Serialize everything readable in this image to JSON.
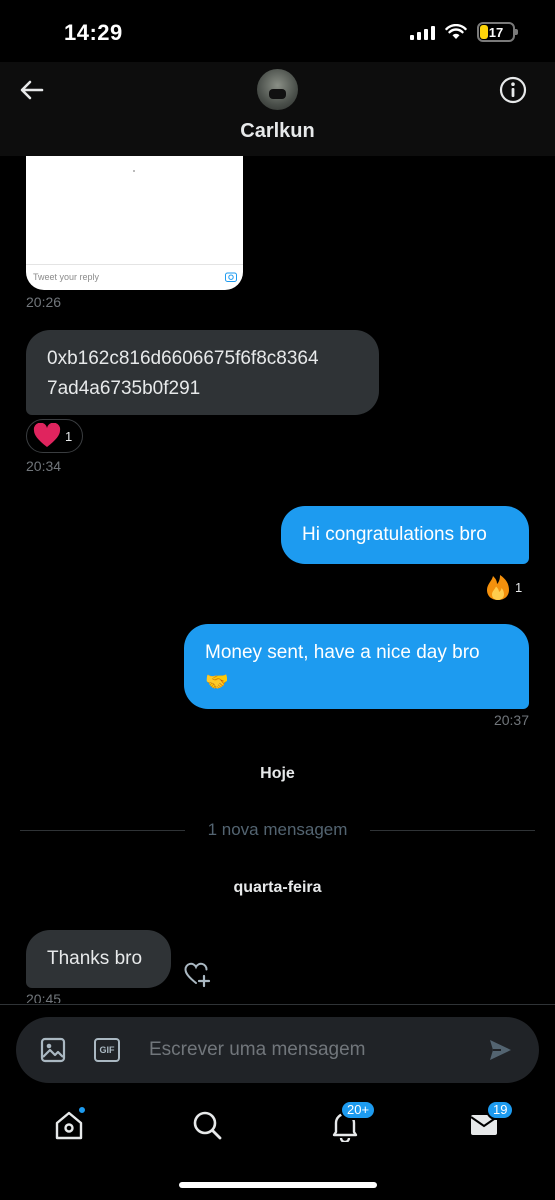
{
  "status_bar": {
    "time": "14:29",
    "battery": "17"
  },
  "header": {
    "name": "Carlkun"
  },
  "preview_card": {
    "reply_placeholder": "Tweet your reply"
  },
  "messages": [
    {
      "side": "in",
      "text": "",
      "time": "20:26"
    },
    {
      "side": "in",
      "text": "0xb162c816d6606675f6f8c8364\n7ad4a6735b0f291",
      "reaction": "heart",
      "reaction_count": "1",
      "time": "20:34"
    },
    {
      "side": "out",
      "text": "Hi congratulations bro",
      "reaction": "fire",
      "reaction_count": "1"
    },
    {
      "side": "out",
      "text": "Money sent, have a nice day bro\n🤝",
      "time": "20:37"
    },
    {
      "side": "in",
      "text": "Thanks bro",
      "time": "20:45"
    }
  ],
  "labels": {
    "today": "Hoje",
    "new_message": "1 nova mensagem",
    "wednesday": "quarta-feira"
  },
  "composer": {
    "placeholder": "Escrever uma mensagem",
    "gif_label": "GIF"
  },
  "tabbar": {
    "notifications_badge": "20+",
    "messages_badge": "19"
  },
  "colors": {
    "accent": "#1d9bf0",
    "bubble_in": "#2f3336",
    "background": "#000000"
  },
  "icons": [
    "back-arrow-icon",
    "info-icon",
    "heart-icon",
    "fire-icon",
    "heart-add-icon",
    "image-icon",
    "gif-icon",
    "send-icon",
    "home-icon",
    "search-icon",
    "bell-icon",
    "mail-icon"
  ]
}
